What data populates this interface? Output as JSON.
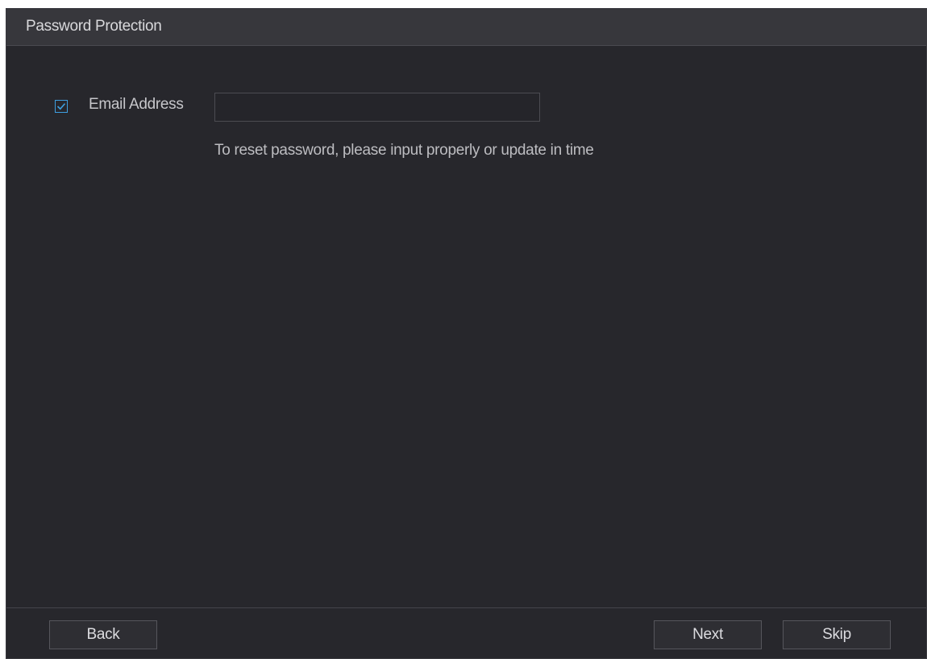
{
  "window": {
    "title": "Password Protection"
  },
  "form": {
    "email_checkbox_checked": true,
    "email_label": "Email Address",
    "email_value": "",
    "hint": "To reset password, please input properly or update in time"
  },
  "footer": {
    "back_label": "Back",
    "next_label": "Next",
    "skip_label": "Skip"
  },
  "colors": {
    "background": "#27272c",
    "titlebar": "#37373c",
    "accent": "#3e9fe0"
  },
  "icons": {
    "checkbox": "check-icon"
  }
}
